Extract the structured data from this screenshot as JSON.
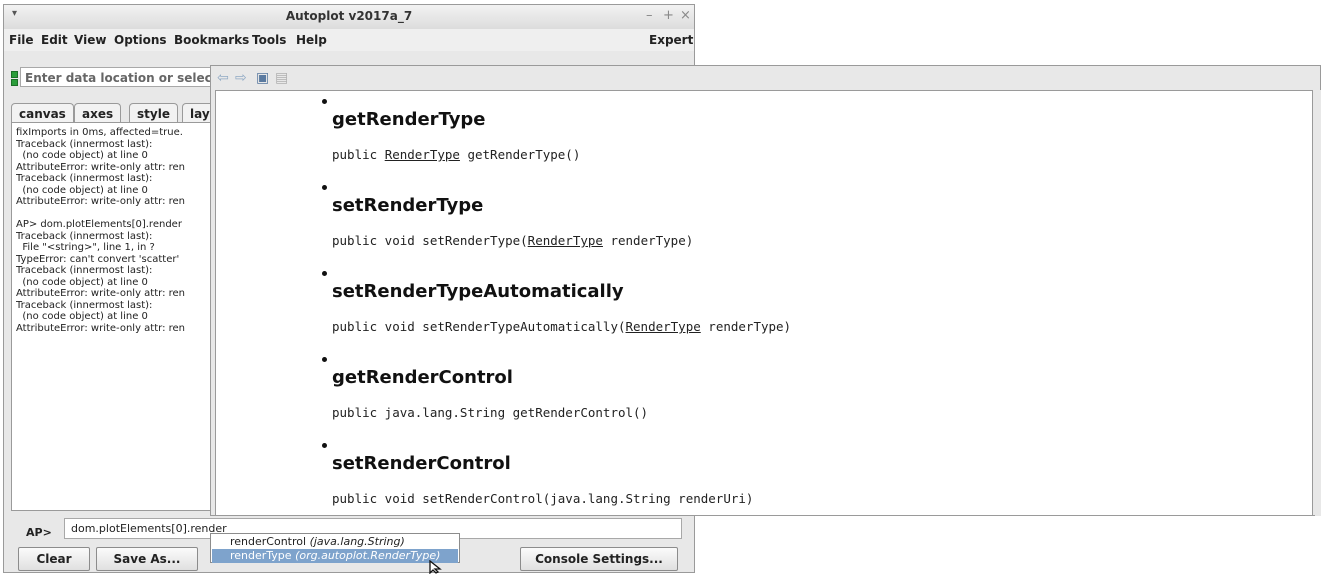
{
  "window": {
    "title": "Autoplot v2017a_7",
    "controls": {
      "minimize": "–",
      "maximize": "+",
      "close": "×",
      "menu": "▾"
    }
  },
  "menubar": {
    "items": [
      "File",
      "Edit",
      "View",
      "Options",
      "Bookmarks",
      "Tools",
      "Help"
    ],
    "expert": "Expert"
  },
  "location": {
    "placeholder": "Enter data location or selec"
  },
  "tabs": [
    "canvas",
    "axes",
    "style",
    "lay"
  ],
  "log_lines": [
    "fixImports in 0ms, affected=true.",
    "Traceback (innermost last):",
    "  (no code object) at line 0",
    "AttributeError: write-only attr: ren",
    "Traceback (innermost last):",
    "  (no code object) at line 0",
    "AttributeError: write-only attr: ren",
    "",
    "AP> dom.plotElements[0].render",
    "Traceback (innermost last):",
    "  File \"<string>\", line 1, in ?",
    "TypeError: can't convert 'scatter'",
    "Traceback (innermost last):",
    "  (no code object) at line 0",
    "AttributeError: write-only attr: ren",
    "Traceback (innermost last):",
    "  (no code object) at line 0",
    "AttributeError: write-only attr: ren"
  ],
  "console": {
    "prompt": "AP>",
    "input_value": "dom.plotElements[0].render",
    "buttons": {
      "clear": "Clear",
      "save_as": "Save As...",
      "settings": "Console Settings..."
    }
  },
  "completions": [
    {
      "name": "renderControl",
      "type": "(java.lang.String)",
      "selected": false
    },
    {
      "name": "renderType",
      "type": "(org.autoplot.RenderType)",
      "selected": true
    }
  ],
  "javadoc": {
    "entries": [
      {
        "name": "getRenderType",
        "sig_pre": "public ",
        "sig_link": "RenderType",
        "sig_post": " getRenderType()"
      },
      {
        "name": "setRenderType",
        "sig_pre": "public void setRenderType(",
        "sig_link": "RenderType",
        "sig_post": " renderType)"
      },
      {
        "name": "setRenderTypeAutomatically",
        "sig_pre": "public void setRenderTypeAutomatically(",
        "sig_link": "RenderType",
        "sig_post": " renderType)"
      },
      {
        "name": "getRenderControl",
        "sig_pre": "public java.lang.String getRenderControl()",
        "sig_link": "",
        "sig_post": ""
      },
      {
        "name": "setRenderControl",
        "sig_pre": "public void setRenderControl(java.lang.String renderUri)",
        "sig_link": "",
        "sig_post": ""
      }
    ]
  }
}
